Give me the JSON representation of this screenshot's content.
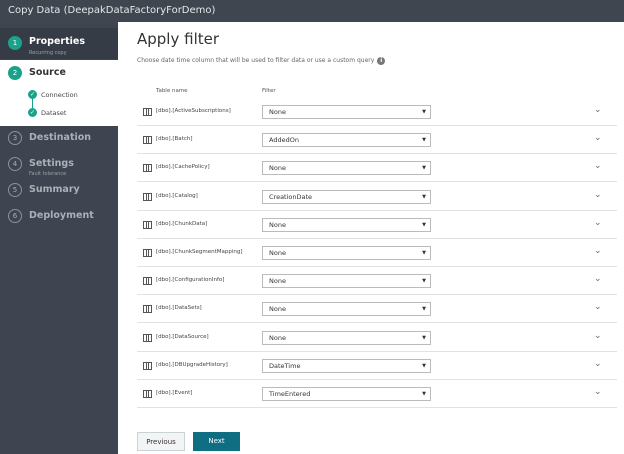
{
  "title": "Copy Data (DeepakDataFactoryForDemo)",
  "steps": [
    {
      "num": "1",
      "label": "Properties",
      "sub": "Recurring copy"
    },
    {
      "num": "2",
      "label": "Source"
    },
    {
      "num": "3",
      "label": "Destination"
    },
    {
      "num": "4",
      "label": "Settings",
      "sub": "Fault tolerance"
    },
    {
      "num": "5",
      "label": "Summary"
    },
    {
      "num": "6",
      "label": "Deployment"
    }
  ],
  "substeps": [
    "Connection",
    "Dataset"
  ],
  "check": "✓",
  "heading": "Apply filter",
  "description": "Choose date time column that will be used to filter data or use a custom query",
  "info": "i",
  "columns": {
    "table": "Table name",
    "filter": "Filter"
  },
  "rows": [
    {
      "table": "[dbo].[ActiveSubscriptions]",
      "filter": "None"
    },
    {
      "table": "[dbo].[Batch]",
      "filter": "AddedOn"
    },
    {
      "table": "[dbo].[CachePolicy]",
      "filter": "None"
    },
    {
      "table": "[dbo].[Catalog]",
      "filter": "CreationDate"
    },
    {
      "table": "[dbo].[ChunkData]",
      "filter": "None"
    },
    {
      "table": "[dbo].[ChunkSegmentMapping]",
      "filter": "None"
    },
    {
      "table": "[dbo].[ConfigurationInfo]",
      "filter": "None"
    },
    {
      "table": "[dbo].[DataSets]",
      "filter": "None"
    },
    {
      "table": "[dbo].[DataSource]",
      "filter": "None"
    },
    {
      "table": "[dbo].[DBUpgradeHistory]",
      "filter": "DateTime"
    },
    {
      "table": "[dbo].[Event]",
      "filter": "TimeEntered"
    }
  ],
  "buttons": {
    "previous": "Previous",
    "next": "Next"
  }
}
